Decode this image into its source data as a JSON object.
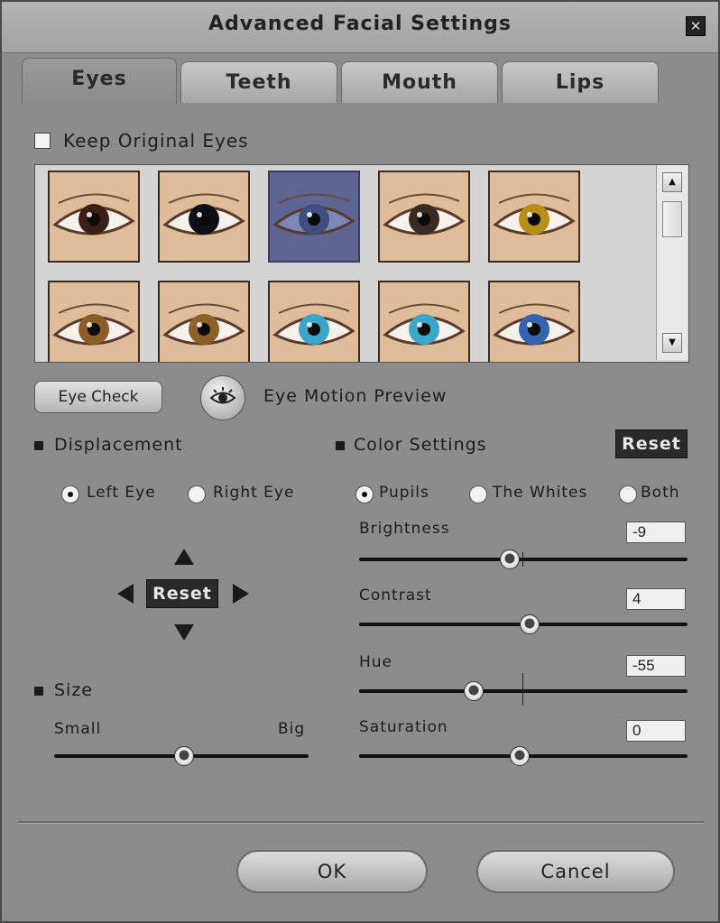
{
  "window": {
    "title": "Advanced Facial Settings",
    "close_icon": "close-icon"
  },
  "tabs": [
    {
      "label": "Eyes",
      "active": true
    },
    {
      "label": "Teeth",
      "active": false
    },
    {
      "label": "Mouth",
      "active": false
    },
    {
      "label": "Lips",
      "active": false
    }
  ],
  "keep_original": {
    "label": "Keep Original Eyes",
    "checked": false
  },
  "gallery": {
    "rows": [
      [
        {
          "iris": "#3b1f17"
        },
        {
          "iris": "#0f0f18"
        },
        {
          "iris": "#3f4e7e",
          "selected": true
        },
        {
          "iris": "#3a2a22"
        },
        {
          "iris": "#b88f18"
        }
      ],
      [
        {
          "iris": "#8a5e26"
        },
        {
          "iris": "#8c6128"
        },
        {
          "iris": "#3aa6c8"
        },
        {
          "iris": "#3aa6c8"
        },
        {
          "iris": "#3464b0"
        }
      ]
    ]
  },
  "buttons": {
    "eye_check": "Eye Check",
    "eye_motion_preview": "Eye Motion Preview",
    "ok": "OK",
    "cancel": "Cancel"
  },
  "displacement": {
    "heading": "Displacement",
    "options": [
      {
        "label": "Left Eye",
        "selected": true
      },
      {
        "label": "Right Eye",
        "selected": false
      }
    ],
    "reset_label": "Reset"
  },
  "size": {
    "heading": "Size",
    "min_label": "Small",
    "max_label": "Big",
    "value": 0.51
  },
  "color_settings": {
    "heading": "Color Settings",
    "reset_label": "Reset",
    "targets": [
      {
        "label": "Pupils",
        "selected": true
      },
      {
        "label": "The Whites",
        "selected": false
      },
      {
        "label": "Both",
        "selected": false
      }
    ],
    "sliders": [
      {
        "label": "Brightness",
        "value": "-9",
        "level": 0.46
      },
      {
        "label": "Contrast",
        "value": "4",
        "level": 0.52
      },
      {
        "label": "Hue",
        "value": "-55",
        "level": 0.35
      },
      {
        "label": "Saturation",
        "value": "0",
        "level": 0.49
      }
    ]
  }
}
